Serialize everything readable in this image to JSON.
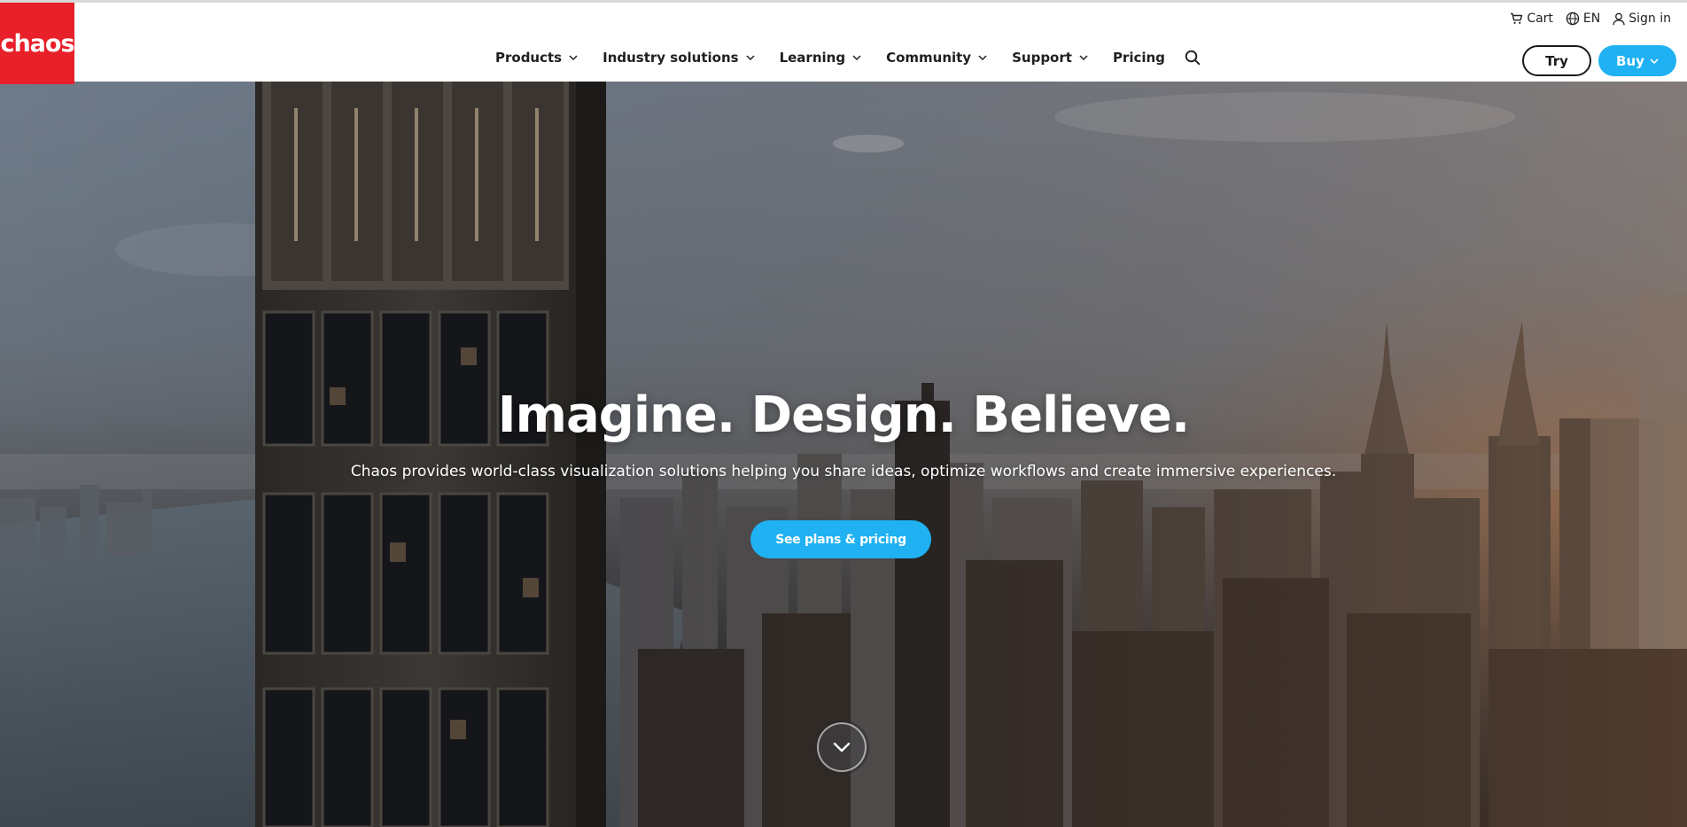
{
  "brand": {
    "logo_text": "chaos",
    "logo_color": "#e8202a"
  },
  "utility": {
    "cart": "Cart",
    "language": "EN",
    "signin": "Sign in"
  },
  "nav": {
    "items": [
      {
        "label": "Products",
        "has_dropdown": true
      },
      {
        "label": "Industry solutions",
        "has_dropdown": true
      },
      {
        "label": "Learning",
        "has_dropdown": true
      },
      {
        "label": "Community",
        "has_dropdown": true
      },
      {
        "label": "Support",
        "has_dropdown": true
      },
      {
        "label": "Pricing",
        "has_dropdown": false
      }
    ],
    "search_icon": "search-icon"
  },
  "header_buttons": {
    "try": "Try",
    "buy": "Buy"
  },
  "hero": {
    "title": "Imagine. Design. Believe.",
    "subtitle": "Chaos provides world-class visualization solutions helping you share ideas, optimize workflows and create immersive experiences.",
    "cta": "See plans & pricing",
    "scroll_icon": "chevron-down-icon"
  },
  "colors": {
    "accent": "#1fb1f2",
    "brand_red": "#e8202a",
    "text_dark": "#1f1f1f"
  }
}
